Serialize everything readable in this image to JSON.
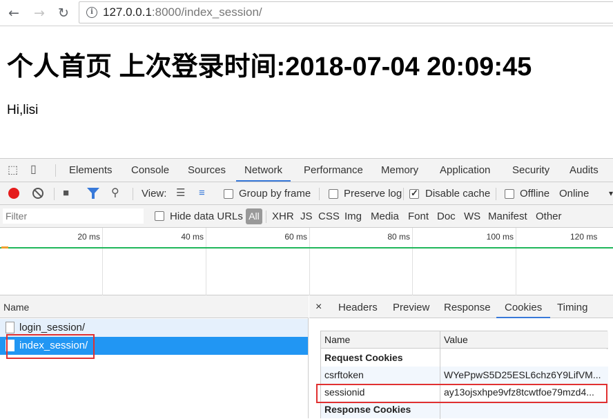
{
  "browser": {
    "url_host": "127.0.0.1",
    "url_rest": ":8000/index_session/",
    "back_glyph": "←",
    "forward_glyph": "→",
    "reload_glyph": "↻"
  },
  "page": {
    "title": "个人首页 上次登录时间:2018-07-04 20:09:45",
    "greeting": "Hi,lisi"
  },
  "devtools": {
    "tabs": [
      "Elements",
      "Console",
      "Sources",
      "Network",
      "Performance",
      "Memory",
      "Application",
      "Security",
      "Audits"
    ],
    "active_tab": "Network",
    "toolbar": {
      "view_label": "View:",
      "group_by_frame": "Group by frame",
      "preserve_log": "Preserve log",
      "disable_cache": "Disable cache",
      "disable_cache_checked": true,
      "offline": "Offline",
      "throttle": "Online"
    },
    "filter": {
      "placeholder": "Filter",
      "hide_data_urls": "Hide data URLs",
      "types": [
        "All",
        "XHR",
        "JS",
        "CSS",
        "Img",
        "Media",
        "Font",
        "Doc",
        "WS",
        "Manifest",
        "Other"
      ]
    },
    "timeline_ticks": [
      "20 ms",
      "40 ms",
      "60 ms",
      "80 ms",
      "100 ms",
      "120 ms"
    ],
    "requests": {
      "header": "Name",
      "items": [
        "login_session/",
        "index_session/"
      ],
      "selected": "index_session/"
    },
    "details": {
      "close_glyph": "×",
      "tabs": [
        "Headers",
        "Preview",
        "Response",
        "Cookies",
        "Timing"
      ],
      "active_tab": "Cookies",
      "table": {
        "col_name": "Name",
        "col_value": "Value",
        "request_section": "Request Cookies",
        "rows": [
          {
            "name": "csrftoken",
            "value": "WYePpwS5D25ESL6chz6Y9LifVM..."
          },
          {
            "name": "sessionid",
            "value": "ay13ojsxhpe9vfz8tcwtfoe79mzd4..."
          }
        ],
        "response_section": "Response Cookies"
      }
    }
  },
  "colors": {
    "accent": "#3879d9",
    "selected_row": "#2196f3",
    "record": "#e51c1c",
    "highlight_box": "#e03030",
    "timeline_green": "#1fb65a"
  }
}
